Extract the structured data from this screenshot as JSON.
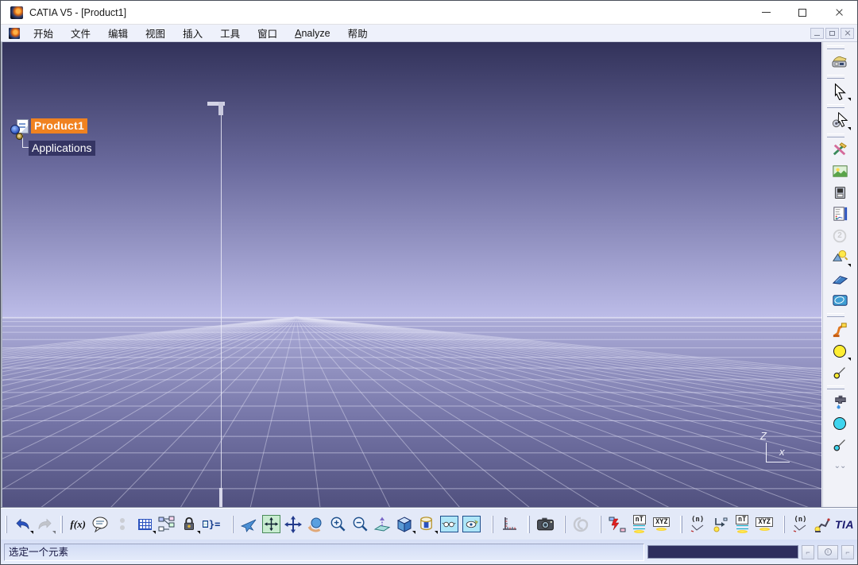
{
  "window": {
    "title": "CATIA V5 - [Product1]",
    "controls": [
      "minimize",
      "maximize",
      "close"
    ],
    "mdi_controls": [
      "minimize",
      "restore",
      "close"
    ]
  },
  "menu": {
    "items": [
      "开始",
      "文件",
      "编辑",
      "视图",
      "插入",
      "工具",
      "窗口",
      "Analyze",
      "帮助"
    ]
  },
  "tree": {
    "nodes": [
      {
        "label": "Product1",
        "selected": true
      },
      {
        "label": "Applications",
        "selected": false
      }
    ]
  },
  "viewport": {
    "axis_labels": {
      "vertical": "Z",
      "horizontal": "x"
    },
    "colors": {
      "sky_top": "#32325a",
      "sky_horizon": "#bcbce8",
      "ground_top": "#adadd9",
      "ground_bottom": "#50507e",
      "grid_line": "#e2e2f5",
      "selection_highlight": "#f08220"
    }
  },
  "glyphs": {
    "formula": "f(x)",
    "equivalent": "}=",
    "task": "nT",
    "frame": "XYZ",
    "jog": "(n)",
    "disabled_viewer": "2"
  },
  "right_toolbar": {
    "icons": [
      "workbench",
      "select-arrow",
      "selection-filter",
      "sketch-tools",
      "image-library",
      "macro",
      "specification-chart",
      "viewer-2d-disabled",
      "light-source",
      "plane-surface",
      "surface-pad",
      "robot",
      "point-large",
      "point-on-line",
      "faucet",
      "circle-large",
      "circle-on-line",
      "overflow-chevron"
    ]
  },
  "bottom_toolbar": {
    "icons": [
      "undo",
      "redo",
      "formula",
      "comment",
      "ellipsis-disabled",
      "design-table",
      "relations",
      "lock",
      "equivalent-dimensions",
      "fly-mode",
      "fit-all-in",
      "pan",
      "rotate",
      "zoom-in",
      "zoom-out",
      "normal-view",
      "isometric-view",
      "named-views",
      "hide-show",
      "swap-visible-space",
      "measure",
      "screen-capture",
      "spiral-disabled",
      "simulation-state",
      "robot-task",
      "frame-position",
      "jog-mechanism",
      "teach",
      "robot-task-2",
      "frame-position-2",
      "jog-mechanism-2",
      "robot-arm"
    ]
  },
  "status": {
    "message": "选定一个元素",
    "command_value": ""
  },
  "brand": {
    "logo": "TIA"
  }
}
